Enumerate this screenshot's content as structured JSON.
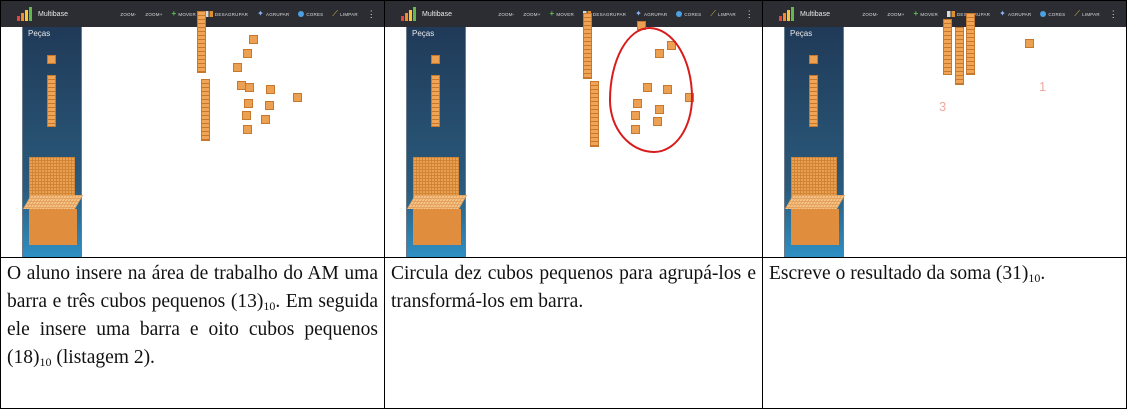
{
  "panels": [
    {
      "brand": "Multibase",
      "tools": [
        "ZOOM-",
        "ZOOM+",
        "MOVER",
        "DESAGRUPAR",
        "AGRUPAR",
        "CORES",
        "LIMPAR"
      ],
      "sidebar_title": "Peças",
      "caption_parts": [
        "O aluno insere na área de trabalho do AM uma barra e três cubos pequenos (13)",
        "10",
        ". Em seguida ele insere uma barra e oito cubos pequenos (18)",
        "10",
        " (listagem 2)."
      ]
    },
    {
      "brand": "Multibase",
      "tools": [
        "ZOOM-",
        "ZOOM+",
        "MOVER",
        "DESAGRUPAR",
        "AGRUPAR",
        "CORES",
        "LIMPAR"
      ],
      "sidebar_title": "Peças",
      "caption_parts": [
        "Circula dez cubos pequenos para agrupá-los e transformá-los em barra."
      ]
    },
    {
      "brand": "Multibase",
      "tools": [
        "ZOOM-",
        "ZOOM+",
        "MOVER",
        "DESAGRUPAR",
        "AGRUPAR",
        "CORES",
        "LIMPAR"
      ],
      "sidebar_title": "Peças",
      "handwriting": [
        "3",
        "1"
      ],
      "caption_parts": [
        "Escreve o resultado da soma (31)",
        "10",
        "."
      ]
    }
  ],
  "colors": {
    "toolbar": "#2b2d33",
    "block_orange": "#eba052",
    "annotation_red": "#d81b1b"
  },
  "icons": [
    "logo-bars-icon",
    "plus-icon",
    "split-icon",
    "group-icon",
    "globe-icon",
    "broom-icon",
    "kebab-icon"
  ]
}
